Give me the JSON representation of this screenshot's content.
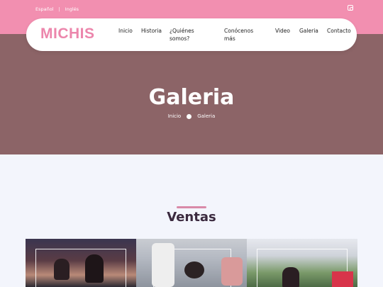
{
  "topbar": {
    "lang_es": "Español",
    "separator": "|",
    "lang_en": "Inglés",
    "social_icon": "instagram-icon"
  },
  "nav": {
    "logo": "MICHIS",
    "items": [
      {
        "label": "Inicio"
      },
      {
        "label": "Historia"
      },
      {
        "label": "¿Quiénes somos?"
      },
      {
        "label": "Conócenos más"
      },
      {
        "label": "Video"
      },
      {
        "label": "Galeria"
      },
      {
        "label": "Contacto"
      }
    ]
  },
  "hero": {
    "title": "Galeria",
    "breadcrumb": {
      "home": "Inicio",
      "current": "Galeria"
    }
  },
  "section": {
    "title": "Ventas"
  },
  "colors": {
    "topbar": "#f28fb0",
    "hero": "#8c6467",
    "logo": "#ec86ac",
    "page_bg": "#f3f5fc",
    "section_title": "#3b2a3f"
  }
}
